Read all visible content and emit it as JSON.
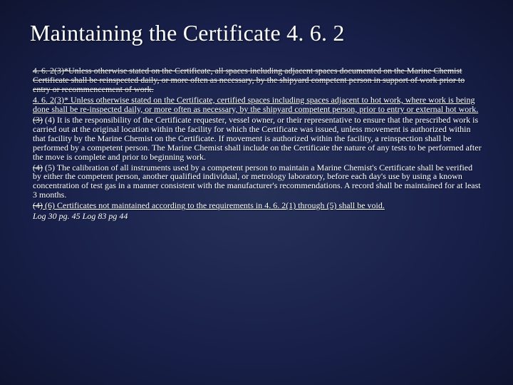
{
  "title": "Maintaining the Certificate 4. 6. 2",
  "para1": "4. 6. 2(3)*Unless otherwise stated on the Certificate, all spaces including adjacent spaces documented on the Marine Chemist Certificate shall be reinspected daily, or more often as necessary, by the shipyard competent person in support of work prior to entry or recommencement of work.",
  "para2": "4. 6. 2(3)* Unless otherwise stated on the Certificate, certified spaces including spaces adjacent to hot work, where work is being done shall be re-inspected daily, or more often as necessary, by the shipyard competent person, prior to entry or external hot work.",
  "para3_strike": "(3)",
  "para3_rest": " (4) It is the responsibility of the Certificate requester, vessel owner, or their representative to ensure that the prescribed work is carried out at the original location within the facility for which the Certificate was issued, unless movement is authorized within that facility by the Marine Chemist on the Certificate. If movement is authorized within the facility, a reinspection shall be performed by a competent person. The Marine Chemist shall include on the Certificate the nature of any tests to be performed after the move is complete and prior to beginning work.",
  "para4_strike": "(4)",
  "para4_rest": " (5) The calibration of all instruments used by a competent person to maintain a Marine Chemist's Certificate shall be verified by either the competent person, another qualified individual, or metrology laboratory, before each day's use by using a known concentration of test gas in a manner consistent with the manufacturer's recommendations. A record shall be maintained for at least 3 months.",
  "para5_strike": "(4)",
  "para5_rest": " (6) Certificates not maintained according to the requirements in 4. 6. 2(1) through (5) shall be void.",
  "para6": "Log 30 pg. 45 Log 83 pg 44"
}
